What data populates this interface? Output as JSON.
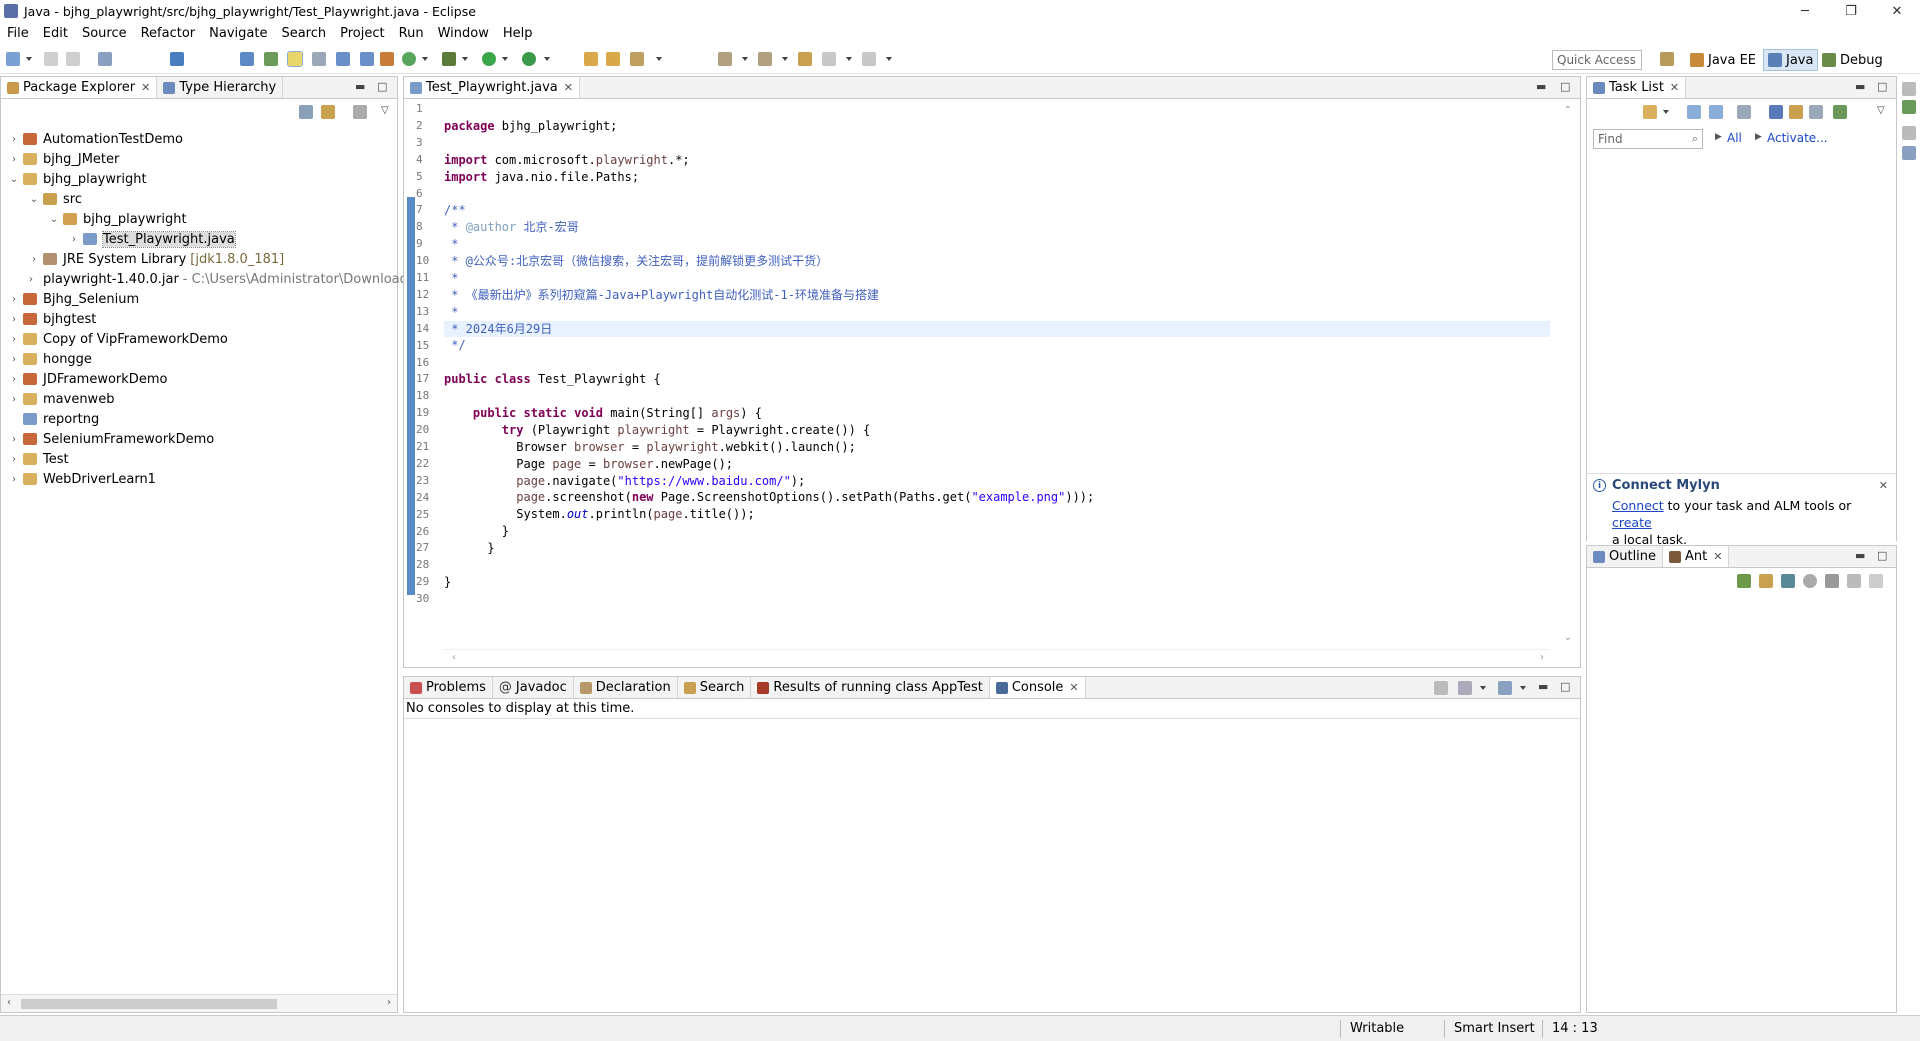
{
  "window": {
    "title": "Java - bjhg_playwright/src/bjhg_playwright/Test_Playwright.java - Eclipse",
    "minimize": "─",
    "maximize": "❐",
    "close": "✕"
  },
  "menu": [
    "File",
    "Edit",
    "Source",
    "Refactor",
    "Navigate",
    "Search",
    "Project",
    "Run",
    "Window",
    "Help"
  ],
  "toolbar": {
    "quick_access_placeholder": "Quick Access",
    "perspectives": [
      "Java EE",
      "Java",
      "Debug"
    ]
  },
  "package_explorer": {
    "tabs": [
      "Package Explorer",
      "Type Hierarchy"
    ],
    "items": [
      {
        "label": "AutomationTestDemo",
        "extra": ""
      },
      {
        "label": "bjhg_JMeter",
        "extra": ""
      },
      {
        "label": "bjhg_playwright",
        "extra": ""
      },
      {
        "label": "src",
        "extra": ""
      },
      {
        "label": "bjhg_playwright",
        "extra": ""
      },
      {
        "label": "Test_Playwright.java",
        "extra": ""
      },
      {
        "label": "JRE System Library",
        "extra": "[jdk1.8.0_181]"
      },
      {
        "label": "playwright-1.40.0.jar",
        "extra": "- C:\\Users\\Administrator\\Downloads"
      },
      {
        "label": "Bjhg_Selenium",
        "extra": ""
      },
      {
        "label": "bjhgtest",
        "extra": ""
      },
      {
        "label": "Copy of VipFrameworkDemo",
        "extra": ""
      },
      {
        "label": "hongge",
        "extra": ""
      },
      {
        "label": "JDFrameworkDemo",
        "extra": ""
      },
      {
        "label": "mavenweb",
        "extra": ""
      },
      {
        "label": "reportng",
        "extra": ""
      },
      {
        "label": "SeleniumFrameworkDemo",
        "extra": ""
      },
      {
        "label": "Test",
        "extra": ""
      },
      {
        "label": "WebDriverLearn1",
        "extra": ""
      }
    ]
  },
  "editor": {
    "tab": "Test_Playwright.java",
    "lines": [
      "",
      "package bjhg_playwright;",
      "",
      "import com.microsoft.playwright.*;",
      "import java.nio.file.Paths;",
      "",
      "/**",
      " * @author 北京-宏哥",
      " *",
      " * @公众号:北京宏哥（微信搜索，关注宏哥，提前解锁更多测试干货）",
      " *",
      " * 《最新出炉》系列初窥篇-Java+Playwright自动化测试-1-环境准备与搭建",
      " *",
      " * 2024年6月29日",
      " */",
      "",
      "public class Test_Playwright {",
      "",
      "    public static void main(String[] args) {",
      "        try (Playwright playwright = Playwright.create()) {",
      "          Browser browser = playwright.webkit().launch();",
      "          Page page = browser.newPage();",
      "          page.navigate(\"https://www.baidu.com/\");",
      "          page.screenshot(new Page.ScreenshotOptions().setPath(Paths.get(\"example.png\")));",
      "          System.out.println(page.title());",
      "        }",
      "      }",
      "",
      "}",
      ""
    ]
  },
  "task_list": {
    "tab": "Task List",
    "find_placeholder": "Find",
    "all_label": "All",
    "activate_label": "Activate...",
    "mylyn_title": "Connect Mylyn",
    "mylyn_link1": "Connect",
    "mylyn_text1": " to your task and ALM tools or ",
    "mylyn_link2": "create",
    "mylyn_text2": "a local task."
  },
  "outline": {
    "tabs": [
      "Outline",
      "Ant"
    ]
  },
  "console": {
    "tabs": [
      "Problems",
      "Javadoc",
      "Declaration",
      "Search",
      "Results of running class AppTest",
      "Console"
    ],
    "message": "No consoles to display at this time."
  },
  "status": {
    "writable": "Writable",
    "insert_mode": "Smart Insert",
    "position": "14 : 13"
  }
}
